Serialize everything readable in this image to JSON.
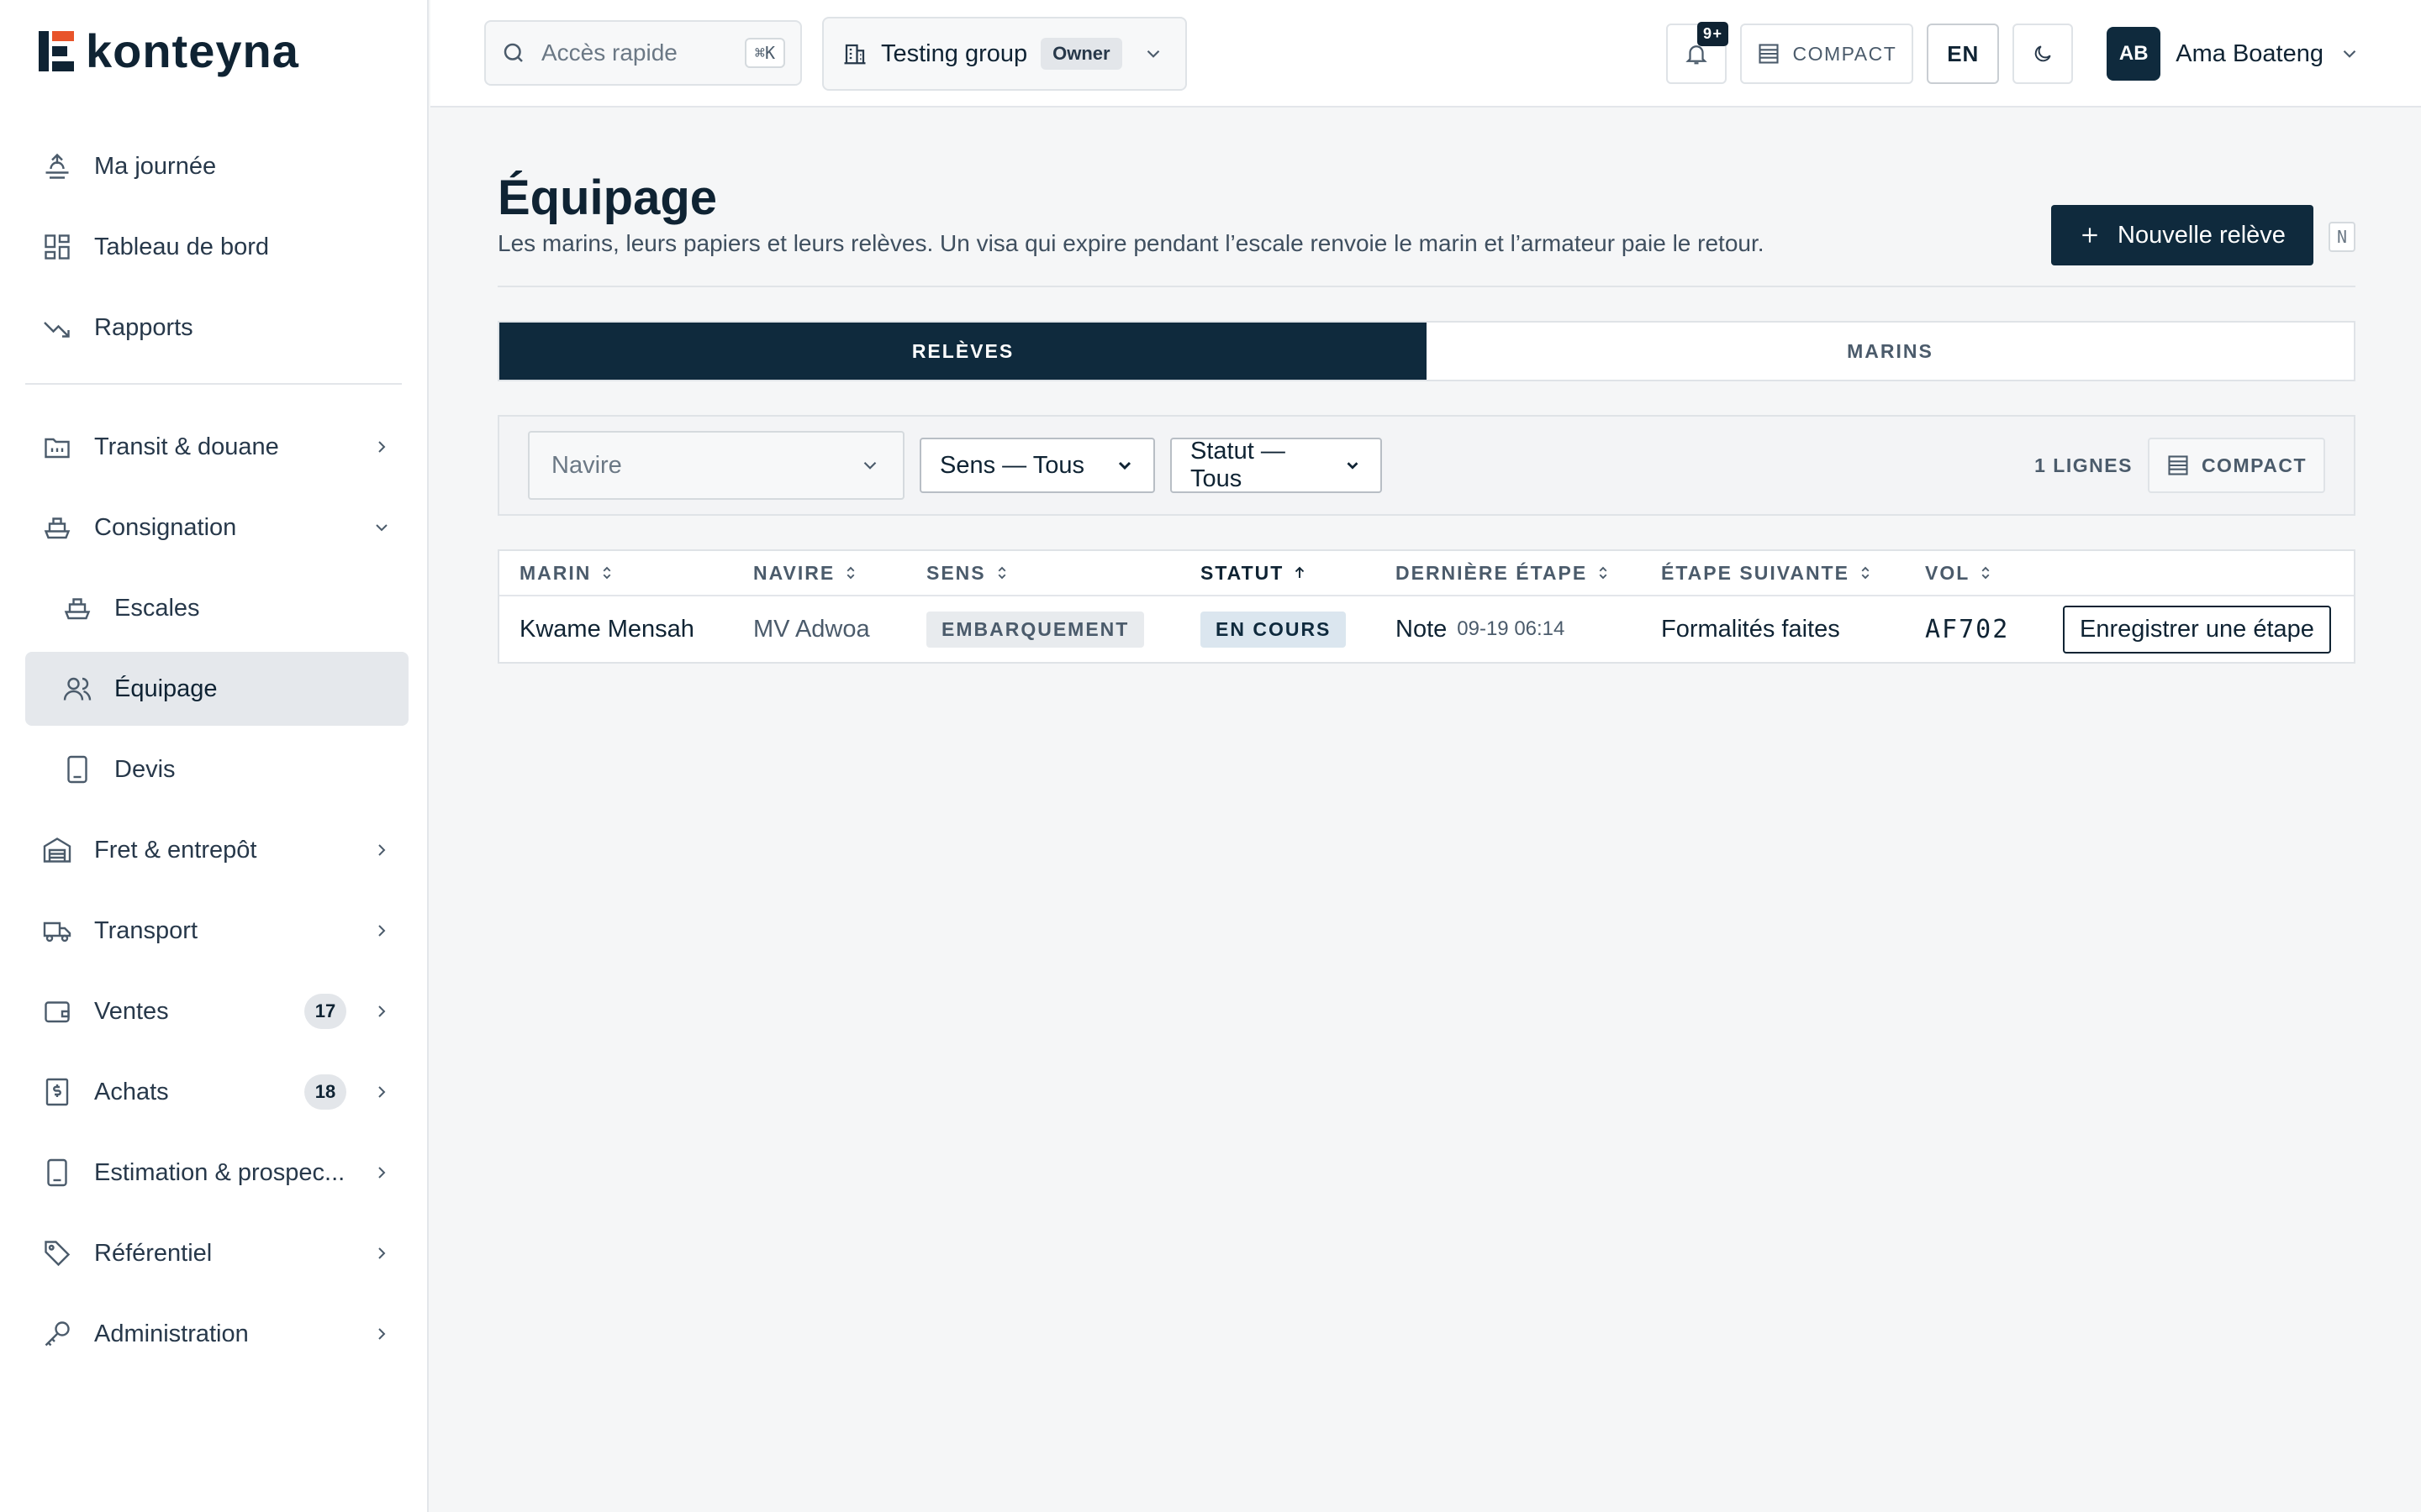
{
  "app": {
    "brand": "konteyna"
  },
  "sidebar": {
    "items_top": [
      {
        "label": "Ma journée",
        "icon": "sunrise-icon"
      },
      {
        "label": "Tableau de bord",
        "icon": "grid-icon"
      },
      {
        "label": "Rapports",
        "icon": "trend-icon"
      }
    ],
    "items": [
      {
        "label": "Transit & douane",
        "icon": "customs-icon"
      },
      {
        "label": "Consignation",
        "icon": "ship-icon"
      },
      {
        "label": "Escales",
        "icon": "ship-icon"
      },
      {
        "label": "Équipage",
        "icon": "users-icon"
      },
      {
        "label": "Devis",
        "icon": "calculator-icon"
      },
      {
        "label": "Fret & entrepôt",
        "icon": "warehouse-icon"
      },
      {
        "label": "Transport",
        "icon": "truck-icon"
      },
      {
        "label": "Ventes",
        "icon": "wallet-icon",
        "badge": "17"
      },
      {
        "label": "Achats",
        "icon": "dollar-receipt-icon",
        "badge": "18"
      },
      {
        "label": "Estimation & prospec...",
        "icon": "calculator-icon"
      },
      {
        "label": "Référentiel",
        "icon": "tag-icon"
      },
      {
        "label": "Administration",
        "icon": "key-icon"
      }
    ]
  },
  "header": {
    "search_placeholder": "Accès rapide",
    "search_shortcut": "⌘K",
    "group_name": "Testing group",
    "group_role": "Owner",
    "notif_count": "9+",
    "compact_label": "COMPACT",
    "lang": "EN",
    "user_initials": "AB",
    "user_name": "Ama Boateng"
  },
  "page": {
    "title": "Équipage",
    "subtitle": "Les marins, leurs papiers et leurs relèves. Un visa qui expire pendant l’escale renvoie le marin et l’armateur paie le retour.",
    "new_button": "Nouvelle relève",
    "new_shortcut": "N"
  },
  "tabs": [
    {
      "label": "RELÈVES",
      "active": true
    },
    {
      "label": "MARINS",
      "active": false
    }
  ],
  "filters": {
    "navire_placeholder": "Navire",
    "sens": "Sens — Tous",
    "statut": "Statut — Tous",
    "lines_count": "1 LIGNES",
    "compact_label": "COMPACT"
  },
  "table": {
    "headers": [
      "MARIN",
      "NAVIRE",
      "SENS",
      "STATUT",
      "DERNIÈRE ÉTAPE",
      "ÉTAPE SUIVANTE",
      "VOL"
    ],
    "sorted_column": "STATUT",
    "rows": [
      {
        "marin": "Kwame Mensah",
        "navire": "MV Adwoa",
        "sens": "EMBARQUEMENT",
        "statut": "EN COURS",
        "derniere_etape": "Note",
        "derniere_etape_date": "09-19 06:14",
        "etape_suivante": "Formalités faites",
        "vol": "AF702",
        "action": "Enregistrer une étape"
      }
    ]
  },
  "colors": {
    "primary": "#0f2a3d",
    "accent": "#e8542a"
  }
}
